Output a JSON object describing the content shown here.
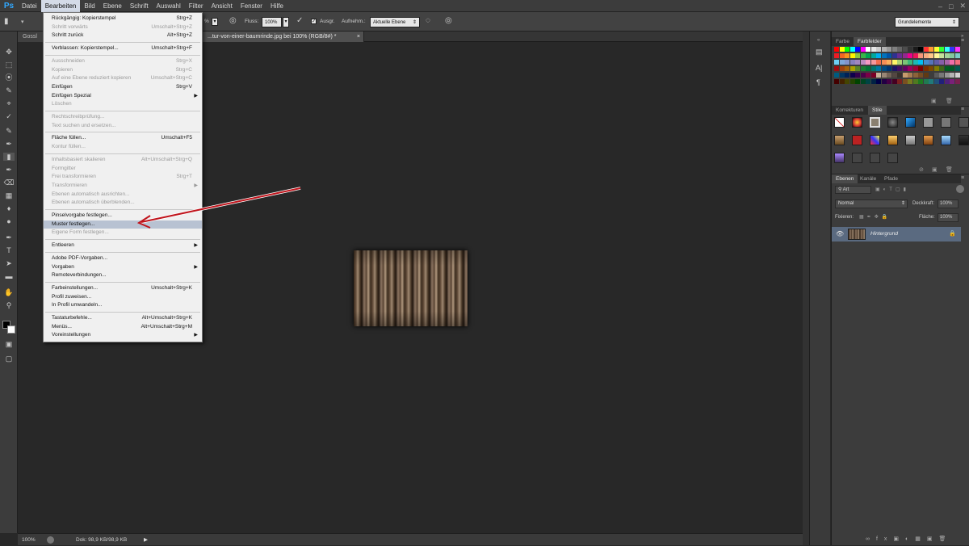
{
  "menubar": {
    "logo": "Ps",
    "items": [
      "Datei",
      "Bearbeiten",
      "Bild",
      "Ebene",
      "Schrift",
      "Auswahl",
      "Filter",
      "Ansicht",
      "Fenster",
      "Hilfe"
    ],
    "active_index": 1
  },
  "options": {
    "opacity_suffix": "%",
    "flow_label": "Fluss:",
    "flow_value": "100%",
    "aligned_label": "Ausgr.",
    "sample_label": "Aufnehm.:",
    "sample_value": "Aktuelle Ebene",
    "workspace": "Grundelemente"
  },
  "tabs": {
    "tab1": "Gossl",
    "tab2": "...tur-von-einer-baumrinde.jpg bei 100% (RGB/8#) *",
    "tab2_close": "×"
  },
  "status": {
    "zoom": "100%",
    "doc": "Dok: 98,9 KB/98,9 KB"
  },
  "edit_menu": {
    "items": [
      {
        "label": "Rückgängig: Kopierstempel",
        "shortcut": "Strg+Z",
        "disabled": false
      },
      {
        "label": "Schritt vorwärts",
        "shortcut": "Umschalt+Strg+Z",
        "disabled": true
      },
      {
        "label": "Schritt zurück",
        "shortcut": "Alt+Strg+Z",
        "disabled": false
      },
      {
        "sep": true
      },
      {
        "label": "Verblassen: Kopierstempel...",
        "shortcut": "Umschalt+Strg+F",
        "disabled": false
      },
      {
        "sep": true
      },
      {
        "label": "Ausschneiden",
        "shortcut": "Strg+X",
        "disabled": true
      },
      {
        "label": "Kopieren",
        "shortcut": "Strg+C",
        "disabled": true
      },
      {
        "label": "Auf eine Ebene reduziert kopieren",
        "shortcut": "Umschalt+Strg+C",
        "disabled": true
      },
      {
        "label": "Einfügen",
        "shortcut": "Strg+V",
        "disabled": false
      },
      {
        "label": "Einfügen Spezial",
        "shortcut": "",
        "disabled": false,
        "submenu": true
      },
      {
        "label": "Löschen",
        "shortcut": "",
        "disabled": true
      },
      {
        "sep": true
      },
      {
        "label": "Rechtschreibprüfung...",
        "shortcut": "",
        "disabled": true
      },
      {
        "label": "Text suchen und ersetzen...",
        "shortcut": "",
        "disabled": true
      },
      {
        "sep": true
      },
      {
        "label": "Fläche füllen...",
        "shortcut": "Umschalt+F5",
        "disabled": false
      },
      {
        "label": "Kontur füllen...",
        "shortcut": "",
        "disabled": true
      },
      {
        "sep": true
      },
      {
        "label": "Inhaltsbasiert skalieren",
        "shortcut": "Alt+Umschalt+Strg+Q",
        "disabled": true
      },
      {
        "label": "Formgitter",
        "shortcut": "",
        "disabled": true
      },
      {
        "label": "Frei transformieren",
        "shortcut": "Strg+T",
        "disabled": true
      },
      {
        "label": "Transformieren",
        "shortcut": "",
        "disabled": true,
        "submenu": true
      },
      {
        "label": "Ebenen automatisch ausrichten...",
        "shortcut": "",
        "disabled": true
      },
      {
        "label": "Ebenen automatisch überblenden...",
        "shortcut": "",
        "disabled": true
      },
      {
        "sep": true
      },
      {
        "label": "Pinselvorgabe festlegen...",
        "shortcut": "",
        "disabled": false
      },
      {
        "label": "Muster festlegen...",
        "shortcut": "",
        "disabled": false,
        "highlight": true
      },
      {
        "label": "Eigene Form festlegen...",
        "shortcut": "",
        "disabled": true
      },
      {
        "sep": true
      },
      {
        "label": "Entleeren",
        "shortcut": "",
        "disabled": false,
        "submenu": true
      },
      {
        "sep": true
      },
      {
        "label": "Adobe PDF-Vorgaben...",
        "shortcut": "",
        "disabled": false
      },
      {
        "label": "Vorgaben",
        "shortcut": "",
        "disabled": false,
        "submenu": true
      },
      {
        "label": "Remoteverbindungen...",
        "shortcut": "",
        "disabled": false
      },
      {
        "sep": true
      },
      {
        "label": "Farbeinstellungen...",
        "shortcut": "Umschalt+Strg+K",
        "disabled": false
      },
      {
        "label": "Profil zuweisen...",
        "shortcut": "",
        "disabled": false
      },
      {
        "label": "In Profil umwandeln...",
        "shortcut": "",
        "disabled": false
      },
      {
        "sep": true
      },
      {
        "label": "Tastaturbefehle...",
        "shortcut": "Alt+Umschalt+Strg+K",
        "disabled": false
      },
      {
        "label": "Menüs...",
        "shortcut": "Alt+Umschalt+Strg+M",
        "disabled": false
      },
      {
        "label": "Voreinstellungen",
        "shortcut": "",
        "disabled": false,
        "submenu": true
      }
    ]
  },
  "panels": {
    "color_tabs": [
      "Farbe",
      "Farbfelder"
    ],
    "adjust_tabs": [
      "Korrekturen",
      "Stile"
    ],
    "layer_tabs": [
      "Ebenen",
      "Kanäle",
      "Pfade"
    ],
    "layer_filter": "Art",
    "blend_mode": "Normal",
    "opacity_label": "Deckkraft:",
    "opacity_value": "100%",
    "lock_label": "Fixieren:",
    "fill_label": "Fläche:",
    "fill_value": "100%",
    "layer_name": "Hintergrund"
  },
  "colors": {
    "accent_ps": "#31a8ff",
    "menu_highlight": "#b8c2d2",
    "arrow": "#c0141c"
  }
}
